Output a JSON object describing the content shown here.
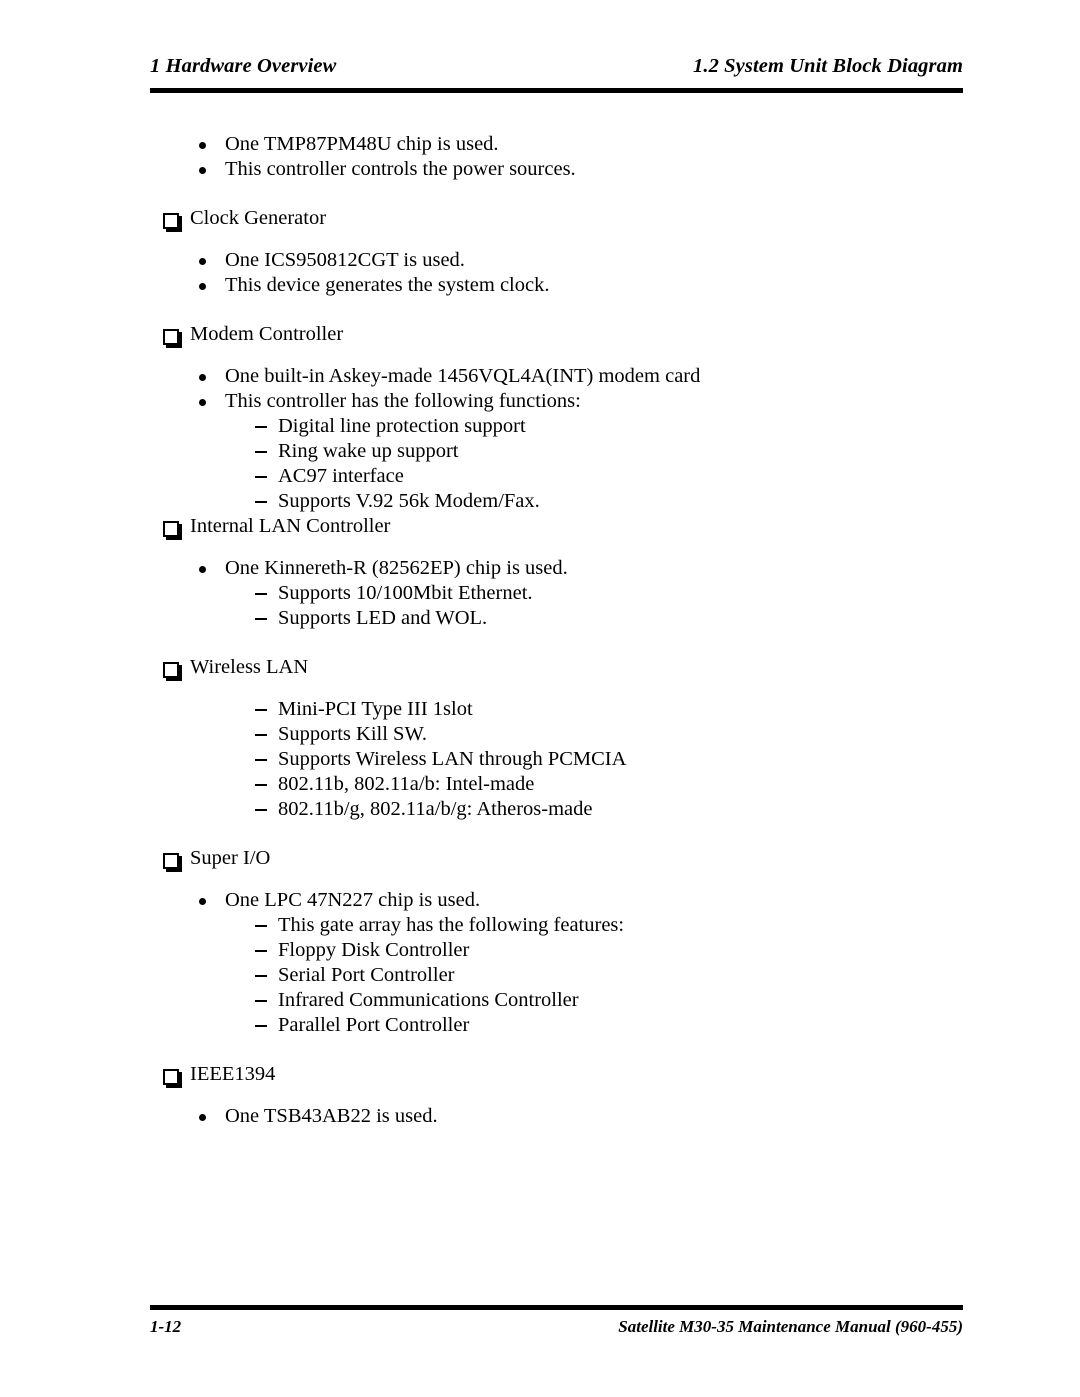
{
  "document": {
    "header": {
      "left": "1  Hardware Overview",
      "right": "1.2 System Unit Block Diagram"
    },
    "footer": {
      "page_number": "1-12",
      "manual_title": "Satellite M30-35 Maintenance Manual (960-455)"
    },
    "markers": {
      "level1": "checkbox-square",
      "level2": "round-bullet",
      "level3": "en-dash"
    },
    "body": [
      {
        "level": 2,
        "text": "One TMP87PM48U chip is used."
      },
      {
        "level": 2,
        "text": "This controller controls the power sources."
      },
      {
        "level": 1,
        "text": "Clock Generator"
      },
      {
        "level": 2,
        "text": "One ICS950812CGT is used."
      },
      {
        "level": 2,
        "text": "This device generates the system clock."
      },
      {
        "level": 1,
        "text": "Modem Controller"
      },
      {
        "level": 2,
        "text": "One built-in Askey-made 1456VQL4A(INT) modem card"
      },
      {
        "level": 2,
        "text": "This controller has the following functions:"
      },
      {
        "level": 3,
        "text": "Digital line protection support"
      },
      {
        "level": 3,
        "text": "Ring wake up support"
      },
      {
        "level": 3,
        "text": "AC97 interface"
      },
      {
        "level": 3,
        "text": "Supports V.92 56k Modem/Fax."
      },
      {
        "level": 1,
        "text": "Internal LAN Controller"
      },
      {
        "level": 2,
        "text": "One Kinnereth-R (82562EP) chip is used."
      },
      {
        "level": 3,
        "text": "Supports 10/100Mbit Ethernet."
      },
      {
        "level": 3,
        "text": "Supports LED and WOL."
      },
      {
        "level": 1,
        "text": "Wireless LAN"
      },
      {
        "level": 3,
        "text": "Mini-PCI Type III 1slot"
      },
      {
        "level": 3,
        "text": "Supports Kill SW."
      },
      {
        "level": 3,
        "text": "Supports Wireless LAN through PCMCIA"
      },
      {
        "level": 3,
        "text": "802.11b, 802.11a/b: Intel-made"
      },
      {
        "level": 3,
        "text": "802.11b/g, 802.11a/b/g: Atheros-made"
      },
      {
        "level": 1,
        "text": "Super I/O"
      },
      {
        "level": 2,
        "text": "One LPC 47N227 chip is used."
      },
      {
        "level": 3,
        "text": "This gate array has the following features:"
      },
      {
        "level": 3,
        "text": "Floppy Disk Controller"
      },
      {
        "level": 3,
        "text": "Serial Port Controller"
      },
      {
        "level": 3,
        "text": "Infrared Communications Controller"
      },
      {
        "level": 3,
        "text": "Parallel Port Controller"
      },
      {
        "level": 1,
        "text": "IEEE1394"
      },
      {
        "level": 2,
        "text": "One TSB43AB22 is used."
      }
    ]
  }
}
